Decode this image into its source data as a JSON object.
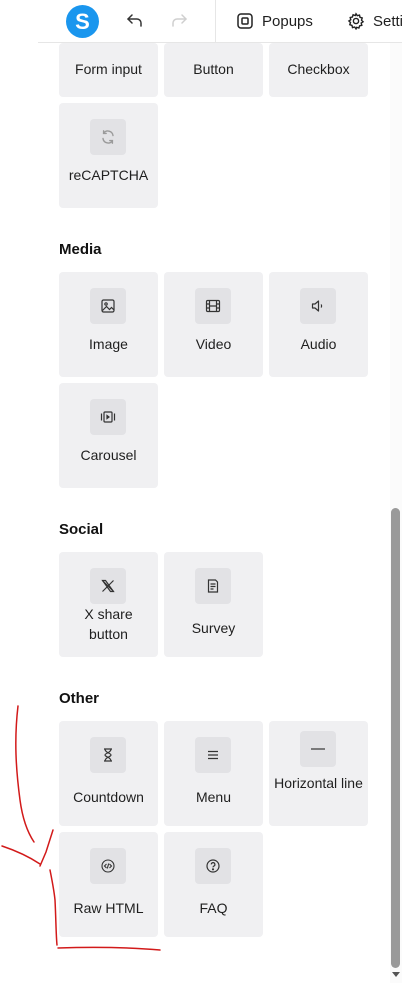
{
  "header": {
    "logo_letter": "S",
    "popups_label": "Popups",
    "settings_label": "Setti"
  },
  "sections": {
    "forms": {
      "items": [
        "Form input",
        "Button",
        "Checkbox",
        "reCAPTCHA"
      ]
    },
    "media": {
      "title": "Media",
      "items": [
        "Image",
        "Video",
        "Audio",
        "Carousel"
      ]
    },
    "social": {
      "title": "Social",
      "items": [
        "X share button",
        "Survey"
      ]
    },
    "other": {
      "title": "Other",
      "items": [
        "Countdown",
        "Menu",
        "Horizontal line",
        "Raw HTML",
        "FAQ"
      ]
    }
  },
  "icons": {
    "recaptcha": "refresh-icon",
    "image": "image-icon",
    "video": "film-icon",
    "audio": "speaker-icon",
    "carousel": "carousel-icon",
    "x_share": "x-logo-icon",
    "survey": "survey-icon",
    "countdown": "hourglass-icon",
    "menu": "hamburger-icon",
    "horizontal_line": "horizontal-line-icon",
    "raw_html": "code-icon",
    "faq": "question-icon"
  },
  "colors": {
    "logo": "#1a96ee",
    "tile_bg": "#f0f0f2",
    "icon_bg": "#e2e2e5",
    "annotation": "#d21a1a"
  }
}
